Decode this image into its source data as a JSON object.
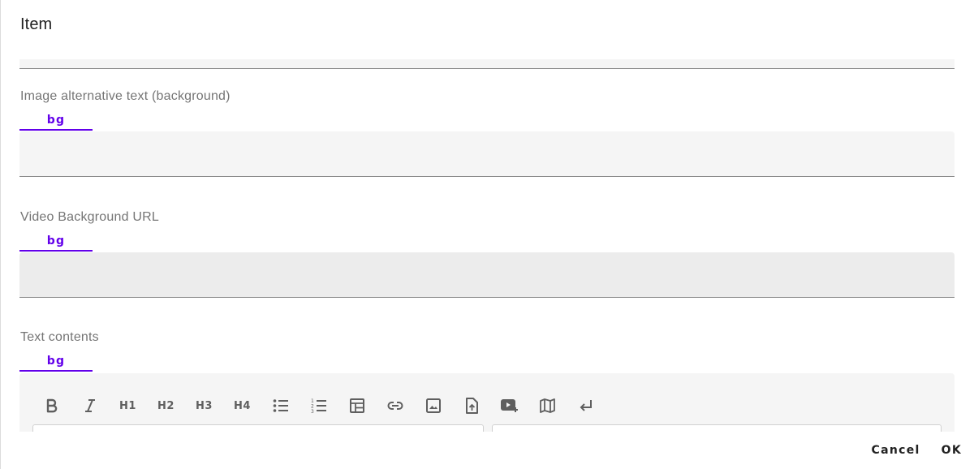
{
  "dialog": {
    "title": "Item"
  },
  "fields": {
    "image_alt": {
      "label": "Image alternative text (background)",
      "tab": "bg",
      "value": ""
    },
    "video_url": {
      "label": "Video Background URL",
      "tab": "bg",
      "value": ""
    },
    "text_contents": {
      "label": "Text contents",
      "tab": "bg"
    }
  },
  "toolbar": {
    "items": [
      {
        "name": "bold",
        "icon": "bold-icon"
      },
      {
        "name": "italic",
        "icon": "italic-icon"
      },
      {
        "name": "heading-1",
        "text": "H1"
      },
      {
        "name": "heading-2",
        "text": "H2"
      },
      {
        "name": "heading-3",
        "text": "H3"
      },
      {
        "name": "heading-4",
        "text": "H4"
      },
      {
        "name": "bulleted-list",
        "icon": "bulleted-list-icon"
      },
      {
        "name": "numbered-list",
        "icon": "numbered-list-icon"
      },
      {
        "name": "table",
        "icon": "table-icon"
      },
      {
        "name": "link",
        "icon": "link-icon"
      },
      {
        "name": "image",
        "icon": "image-icon"
      },
      {
        "name": "upload-file",
        "icon": "file-upload-icon"
      },
      {
        "name": "video",
        "icon": "video-add-icon"
      },
      {
        "name": "map",
        "icon": "map-icon"
      },
      {
        "name": "line-break",
        "icon": "return-arrow-icon"
      }
    ]
  },
  "actions": {
    "cancel": "Cancel",
    "ok": "OK"
  },
  "colors": {
    "accent": "#6200ea",
    "field_bg": "#f5f5f5",
    "field_hover_bg": "#ececec",
    "label": "#757575"
  }
}
